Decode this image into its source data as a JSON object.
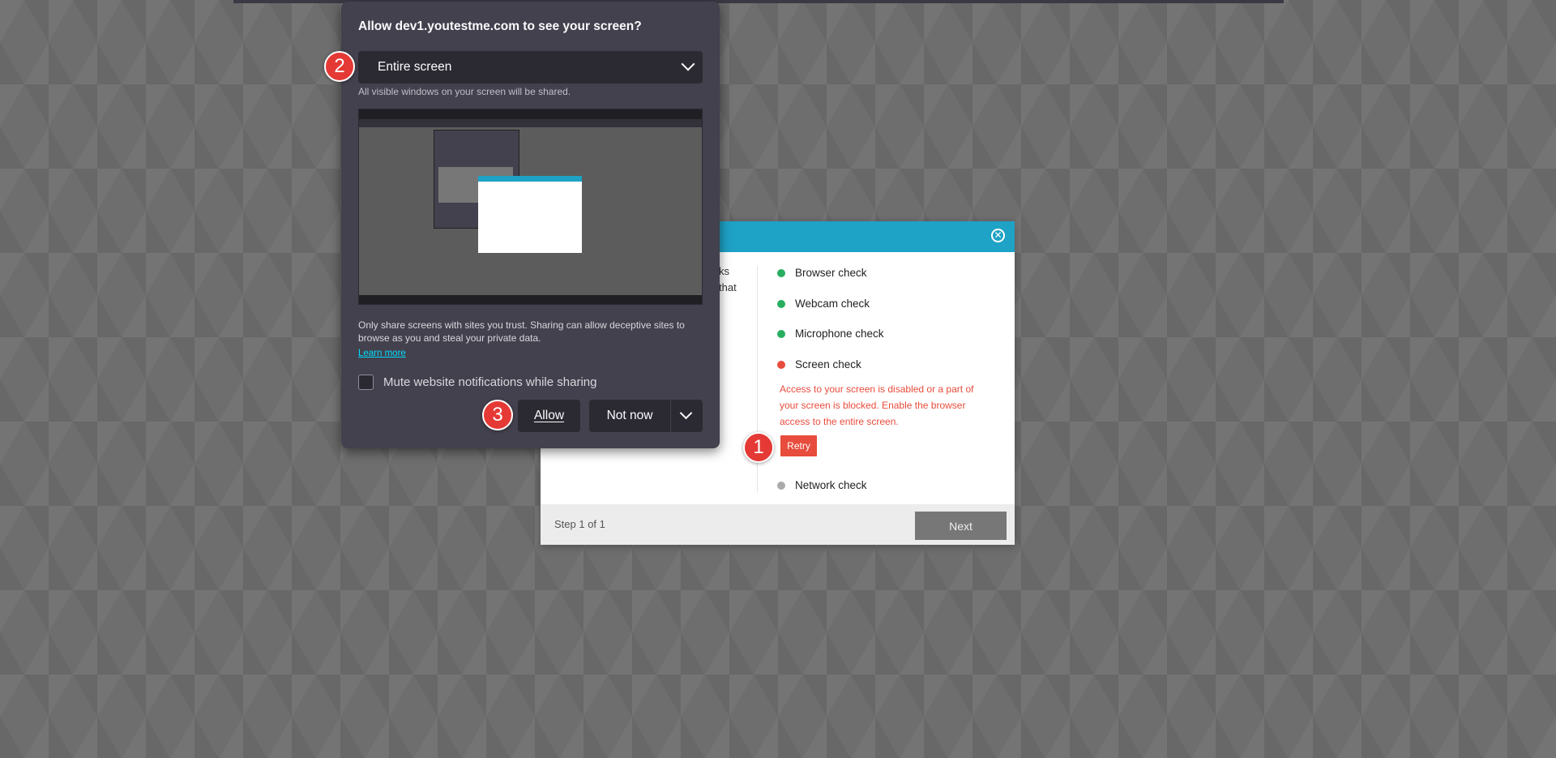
{
  "share_dialog": {
    "title": "Allow dev1.youtestme.com to see your screen?",
    "source_selected": "Entire screen",
    "source_hint": "All visible windows on your screen will be shared.",
    "warning": "Only share screens with sites you trust. Sharing can allow deceptive sites to browse as you and steal your private data.",
    "learn_more": "Learn more",
    "mute_label": "Mute website notifications while sharing",
    "mute_checked": false,
    "allow_label": "Allow",
    "not_now_label": "Not now"
  },
  "test_modal": {
    "left_text_lines": [
      "ks",
      "that"
    ],
    "checks": [
      {
        "label": "Browser check",
        "status": "ok"
      },
      {
        "label": "Webcam check",
        "status": "ok"
      },
      {
        "label": "Microphone check",
        "status": "ok"
      },
      {
        "label": "Screen check",
        "status": "error"
      },
      {
        "label": "Network check",
        "status": "pending"
      }
    ],
    "screen_error": "Access to your screen is disabled or a part of your screen is blocked. Enable the browser access to the entire screen.",
    "retry_label": "Retry",
    "step_text": "Step 1 of 1",
    "next_label": "Next"
  },
  "markers": [
    "1",
    "2",
    "3"
  ],
  "colors": {
    "accent": "#1ea2c6",
    "ok": "#27ae60",
    "error": "#e74c3c",
    "pending": "#aaaaaa",
    "dialog_bg": "#42414d",
    "marker": "#e53935"
  },
  "icons": {
    "close": "close-icon",
    "dropdown": "chevron-down-icon"
  }
}
